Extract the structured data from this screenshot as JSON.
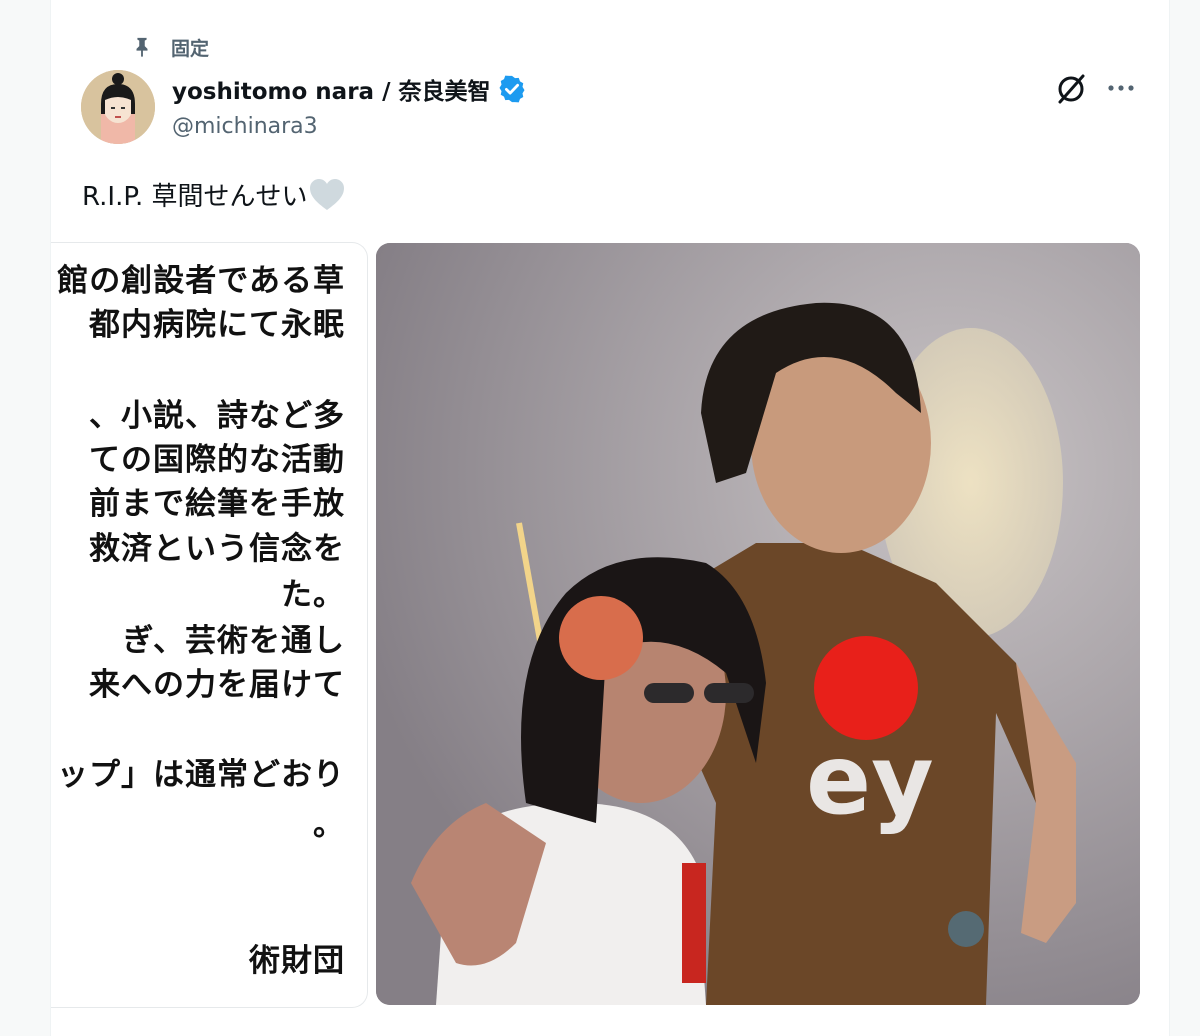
{
  "pinned": {
    "label": "固定",
    "icon": "pin-icon"
  },
  "author": {
    "display_name": "yoshitomo nara / 奈良美智",
    "handle": "@michinara3",
    "verified": true,
    "verified_color": "#1d9bf0"
  },
  "tweet": {
    "text": "R.I.P. 草間せんせい",
    "emoji_icon": "white-heart-icon"
  },
  "media": {
    "notice_lines": [
      "館の創設者である草",
      "都内病院にて永眠",
      "",
      "、小説、詩など多",
      "ての国際的な活動",
      "前まで絵筆を手放",
      "救済という信念を",
      "た。",
      "ぎ、芸術を通し",
      "来への力を届けて",
      "",
      "ップ」は通常どおり",
      "。",
      "",
      "",
      "術財団"
    ],
    "photo_shirt_text": "ey"
  },
  "colors": {
    "text_primary": "#0f1419",
    "text_secondary": "#536471",
    "accent": "#1d9bf0",
    "polka_red": "#e8201a"
  }
}
